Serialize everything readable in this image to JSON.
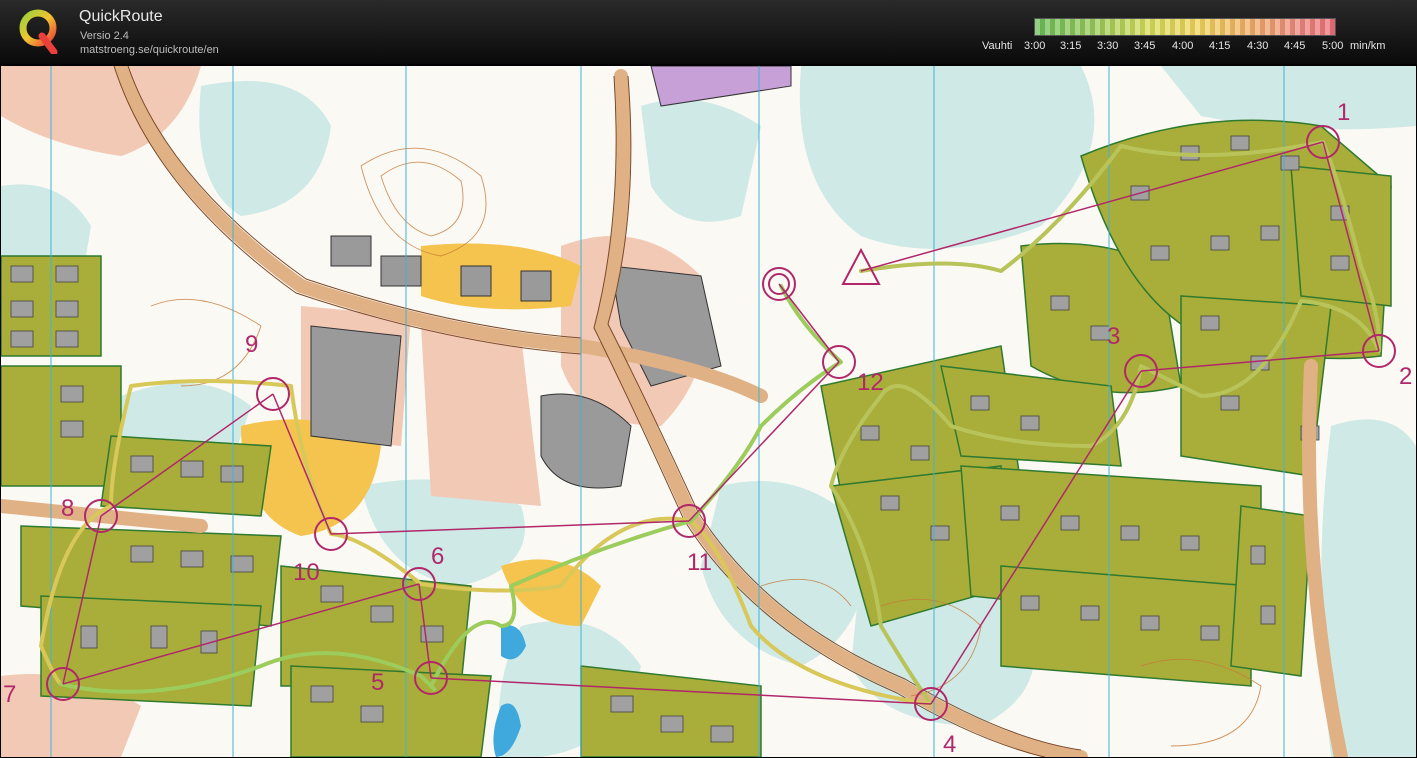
{
  "app": {
    "title": "QuickRoute",
    "version": "Versio 2.4",
    "url": "matstroeng.se/quickroute/en"
  },
  "pace_scale": {
    "label": "Vauhti",
    "ticks": [
      "3:00",
      "3:15",
      "3:30",
      "3:45",
      "4:00",
      "4:15",
      "4:30",
      "4:45",
      "5:00"
    ],
    "unit": "min/km",
    "colors": [
      "#6cbf5a",
      "#9ccc5b",
      "#d8de5b",
      "#f2d55d",
      "#f2b06a",
      "#ee8a80",
      "#ee6f7a"
    ]
  },
  "map": {
    "controls": [
      "1",
      "2",
      "3",
      "4",
      "5",
      "6",
      "7",
      "8",
      "9",
      "10",
      "11",
      "12"
    ],
    "colors": {
      "course": "#b0286a",
      "route": "#b8c45a",
      "housing": "#a9ad3a",
      "open_land": "#f2c9b5",
      "forest": "#cfe9e6",
      "road": "#e8c49e",
      "magnetic_north": "#3fb2d6"
    }
  }
}
